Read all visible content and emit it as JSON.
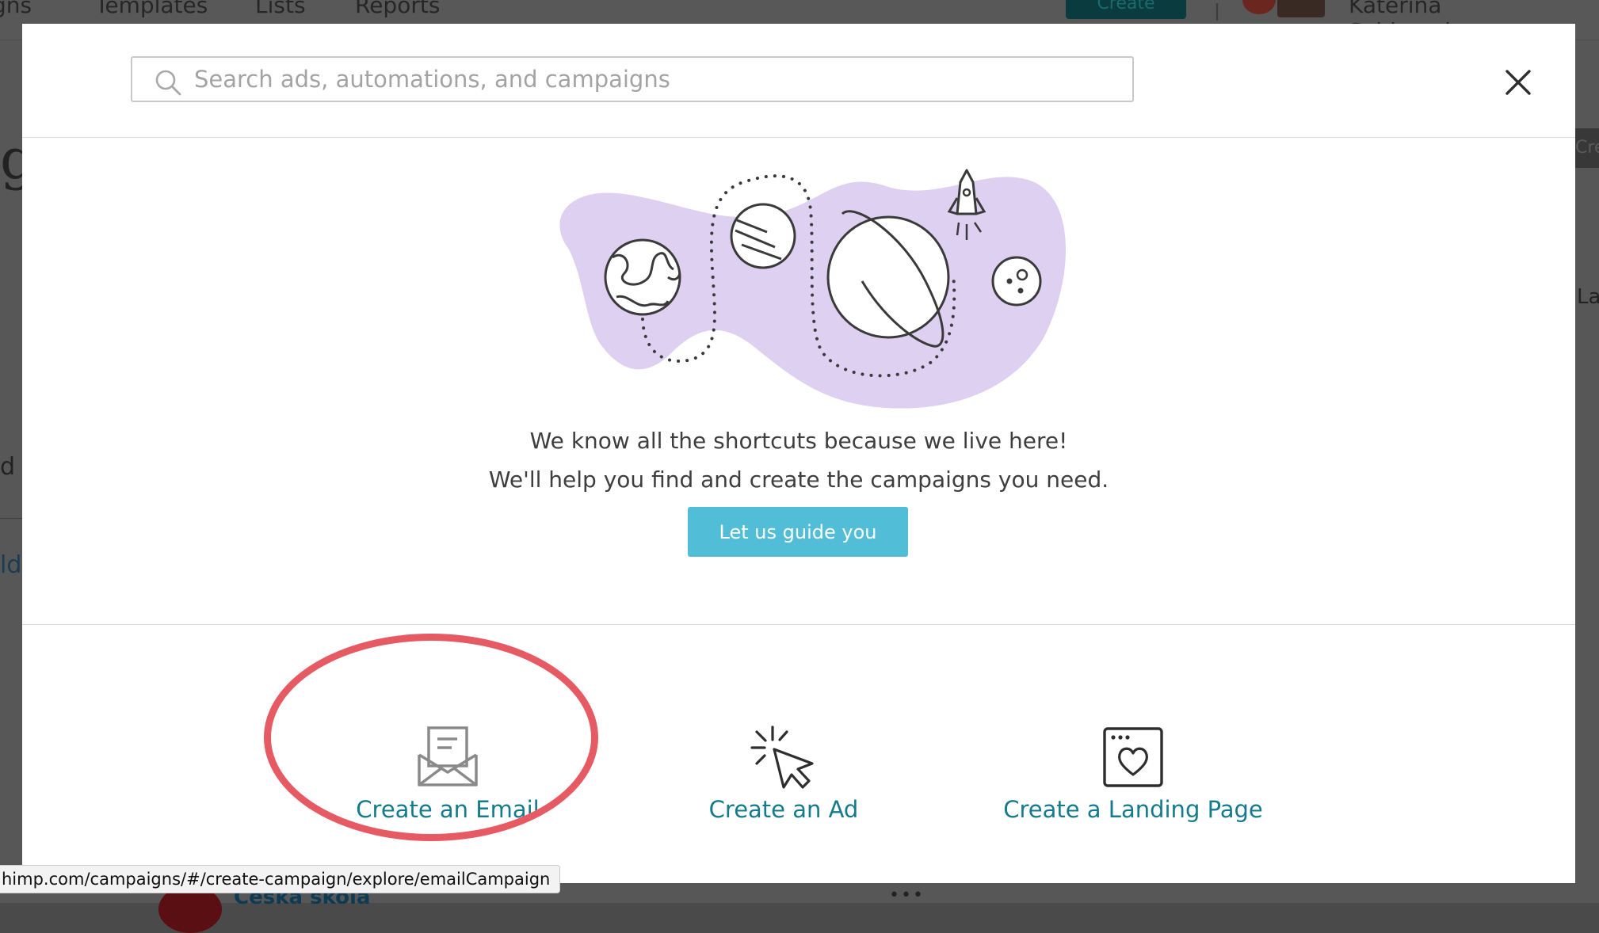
{
  "background": {
    "nav_items": [
      "gns",
      "Templates",
      "Lists",
      "Reports"
    ],
    "create_label": "Create",
    "user_name": "Katerina Svidrnochova",
    "left_fragments": [
      "g",
      "d",
      "ld"
    ],
    "right_fragments": [
      "Cre",
      "La"
    ],
    "bottom_text": "Česká škola",
    "bottom_dots": "•••"
  },
  "modal": {
    "search": {
      "placeholder": "Search ads, automations, and campaigns",
      "value": ""
    },
    "intro": {
      "line1": "We know all the shortcuts because we live here!",
      "line2": "We'll help you find and create the campaigns you need."
    },
    "guide_button_label": "Let us guide you",
    "actions": [
      {
        "label": "Create an Email",
        "icon": "envelope-icon"
      },
      {
        "label": "Create an Ad",
        "icon": "cursor-click-icon"
      },
      {
        "label": "Create a Landing Page",
        "icon": "landing-page-heart-icon"
      }
    ]
  },
  "status_bar": {
    "url": "himp.com/campaigns/#/create-campaign/explore/emailCampaign"
  },
  "colors": {
    "accent": "#52bdd6",
    "link": "#147b8c",
    "highlight": "#e65a63",
    "blob": "#ddd0f1"
  }
}
